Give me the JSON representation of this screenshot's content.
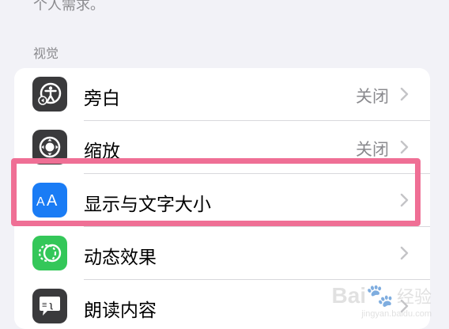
{
  "top_text": "个人需求。",
  "section_header": "视觉",
  "rows": [
    {
      "label": "旁白",
      "value": "关闭",
      "icon": "voiceover-icon"
    },
    {
      "label": "缩放",
      "value": "关闭",
      "icon": "zoom-icon"
    },
    {
      "label": "显示与文字大小",
      "value": "",
      "icon": "display-text-size-icon"
    },
    {
      "label": "动态效果",
      "value": "",
      "icon": "motion-icon"
    },
    {
      "label": "朗读内容",
      "value": "",
      "icon": "spoken-content-icon"
    }
  ],
  "colors": {
    "background": "#f2f2f7",
    "highlight": "#ef6f95",
    "display_icon": "#1a7cf5",
    "motion_icon": "#34c759",
    "dark_icon": "#3a3a3c"
  },
  "watermark": {
    "brand": "Bai",
    "paw": "🐾",
    "zh": "经验",
    "url": "jingyan.baidu.com"
  }
}
